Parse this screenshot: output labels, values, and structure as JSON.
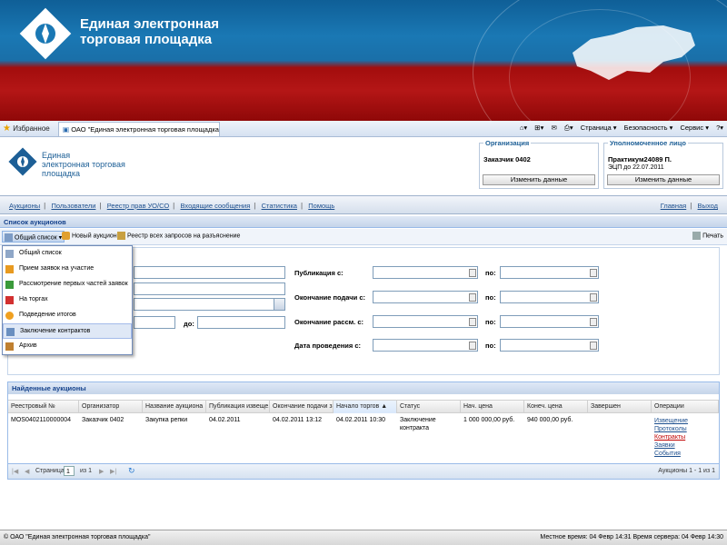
{
  "banner": {
    "title_line1": "Единая электронная",
    "title_line2": "торговая площадка"
  },
  "browser": {
    "favorites": "Избранное",
    "tab_title": "ОАО \"Единая электронная торговая площадка\"",
    "tools": [
      "Страница ▾",
      "Безопасность ▾",
      "Сервис ▾",
      "?▾"
    ]
  },
  "app_header": {
    "logo_line1": "Единая",
    "logo_line2": "электронная торговая",
    "logo_line3": "площадка",
    "org": {
      "legend": "Организация",
      "value": "Заказчик 0402",
      "button": "Изменить данные"
    },
    "person": {
      "legend": "Уполномоченное лицо",
      "value": "Практикум24089 П.",
      "sub": "ЭЦП до 22.07.2011",
      "button": "Изменить данные"
    }
  },
  "nav": {
    "links": [
      "Аукционы",
      "Пользователи",
      "Реестр прав УО/СО",
      "Входящие сообщения",
      "Статистика",
      "Помощь"
    ],
    "right": [
      "Главная",
      "Выход"
    ]
  },
  "panel": {
    "title": "Список аукционов",
    "toolbar": {
      "general": "Общий список ▾",
      "new": "Новый аукцион",
      "registry": "Реестр всех запросов на разъяснение",
      "print": "Печать"
    }
  },
  "menu": {
    "items": [
      "Общий список",
      "Прием заявок на участие",
      "Рассмотрение первых частей заявок",
      "На торгах",
      "Подведение итогов",
      "Заключение контрактов",
      "Архив"
    ]
  },
  "form": {
    "to_label": "до:",
    "publication": "Публикация с:",
    "end_submission": "Окончание подачи с:",
    "end_review": "Окончание рассм. с:",
    "hold_date": "Дата проведения с:",
    "po": "по:"
  },
  "results": {
    "title": "Найденные аукционы",
    "columns": [
      "Реестровый №",
      "Организатор",
      "Название аукциона",
      "Публикация извеще...",
      "Окончание подачи з...",
      "Начало торгов ▲",
      "Статус",
      "Нач. цена",
      "Конеч. цена",
      "Завершен",
      "Операции"
    ],
    "row": {
      "reg": "MOS0402110000004",
      "org": "Заказчик 0402",
      "name": "Закупка репки",
      "pub": "04.02.2011",
      "end": "04.02.2011 13:12",
      "start": "04.02.2011 10:30",
      "status_line1": "Заключение",
      "status_line2": "контракта",
      "start_price": "1 000 000,00 руб.",
      "final_price": "940 000,00 руб.",
      "done": "",
      "ops": [
        "Извещение",
        "Протоколы",
        "Контракты",
        "Заявки",
        "События"
      ]
    },
    "pager": {
      "page_label": "Страница",
      "page": "1",
      "of": "из 1",
      "summary": "Аукционы 1 - 1 из 1"
    }
  },
  "statusbar": {
    "left": "© ОАО \"Единая электронная торговая площадка\"",
    "right": "Местное время: 04 Февр 14:31 Время сервера: 04 Февр 14:30"
  },
  "colors": {
    "brand_blue": "#1d5f96",
    "banner_red": "#b41616",
    "link": "#1d4f8e"
  }
}
